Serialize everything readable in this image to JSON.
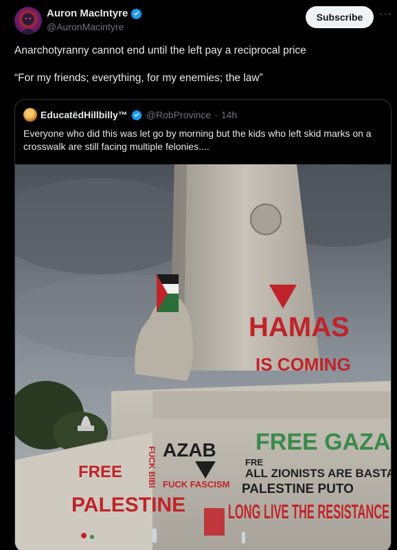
{
  "author": {
    "display_name": "Auron MacIntyre",
    "handle": "@AuronMacintyre",
    "verified": true
  },
  "actions": {
    "subscribe_label": "Subscribe",
    "more_icon": "more-horizontal-icon"
  },
  "post": {
    "text_line1": "Anarchotyranny cannot end until the left pay a reciprocal price",
    "text_line2": "“For my friends; everything, for my enemies; the law”"
  },
  "quoted_post": {
    "display_name": "EducatëdHillbilly™",
    "handle": "@RobProvince",
    "separator": "·",
    "time": "14h",
    "verified": true,
    "text": "Everyone who did this was let go by morning but the kids who left skid marks on a crosswalk are still facing multiple felonies....",
    "image": {
      "graffiti": {
        "hamas": "HAMAS",
        "is_coming": "IS COMING",
        "free_gaza": "FREE GAZA",
        "azab": "AZAB",
        "all_zionists": "ALL ZIONISTS ARE BASTARDS",
        "fre": "FRE",
        "palestine_puto": "PALESTINE PUTO",
        "free": "FREE",
        "palestine": "PALESTINE",
        "long_live": "LONG LIVE THE RESISTANCE",
        "fuck_fascism": "FUCK FASCISM",
        "fuck_bibi": "FUCK BIBI"
      }
    }
  },
  "colors": {
    "background": "#000000",
    "verified_blue": "#1d9bf0",
    "graffiti_red": "#c0232a",
    "graffiti_green": "#3a8a4a"
  }
}
